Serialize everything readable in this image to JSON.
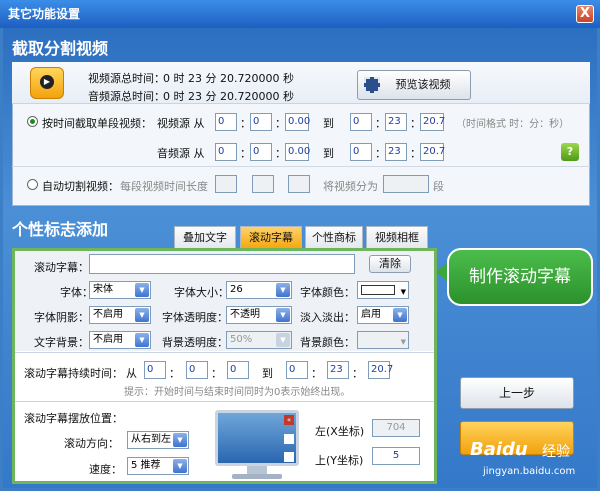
{
  "window": {
    "title": "其它功能设置",
    "close": "X"
  },
  "section1": {
    "title": "截取分割视频",
    "video_total_label": "视频源总时间：",
    "video_total": "0 时 23 分 20.720000 秒",
    "audio_total_label": "音频源总时间：",
    "audio_total": "0 时 23 分 20.720000 秒",
    "preview_btn": "预览该视频",
    "by_time_label": "按时间截取单段视频：",
    "video_src": "视频源 从",
    "audio_src": "音频源 从",
    "to": "到",
    "colon": "：",
    "video_from": [
      "0",
      "0",
      "0.00"
    ],
    "video_to": [
      "0",
      "23",
      "20.7"
    ],
    "audio_from": [
      "0",
      "0",
      "0.00"
    ],
    "audio_to": [
      "0",
      "23",
      "20.7"
    ],
    "time_format": "（时间格式 时：分：秒）",
    "help": "?",
    "auto_label": "自动切割视频：",
    "seg_len": "每段视频时间长度",
    "split_into": "将视频分为",
    "segment": "段"
  },
  "section2": {
    "title": "个性标志添加",
    "tabs": [
      "叠加文字",
      "滚动字幕",
      "个性商标",
      "视频相框"
    ],
    "active_tab": "滚动字幕",
    "scroll_text_label": "滚动字幕：",
    "scroll_text": "",
    "clear_btn": "清除",
    "font_label": "字体：",
    "font": "宋体",
    "size_label": "字体大小：",
    "size": "26",
    "color_label": "字体颜色：",
    "shadow_label": "字体阴影：",
    "shadow": "不启用",
    "opacity_label": "字体透明度：",
    "opacity": "不透明",
    "fade_label": "淡入淡出：",
    "fade": "启用",
    "bg_label": "文字背景：",
    "bg": "不启用",
    "bg_opacity_label": "背景透明度：",
    "bg_opacity": "50%",
    "bg_color_label": "背景颜色：",
    "duration_label": "滚动字幕持续时间：",
    "from": "从",
    "to": "到",
    "dur_from": [
      "0",
      "0",
      "0"
    ],
    "dur_to": [
      "0",
      "23",
      "20.7"
    ],
    "hint": "提示：开始时间与结束时间同时为0表示始终出现。",
    "pos_label": "滚动字幕摆放位置：",
    "direction_label": "滚动方向：",
    "direction": "从右到左",
    "speed_label": "速度：",
    "speed": "5 推荐",
    "left_label": "左(X坐标)",
    "left": "704",
    "top_label": "上(Y坐标)",
    "top": "5"
  },
  "callout": "制作滚动字幕",
  "prev_btn": "上一步",
  "watermark": {
    "brand": "Baidu",
    "text": "经验",
    "url": "jingyan.baidu.com"
  },
  "colors": {
    "accent": "#f6a810",
    "callout": "#3aa83a",
    "title": "#1d5fc0"
  }
}
